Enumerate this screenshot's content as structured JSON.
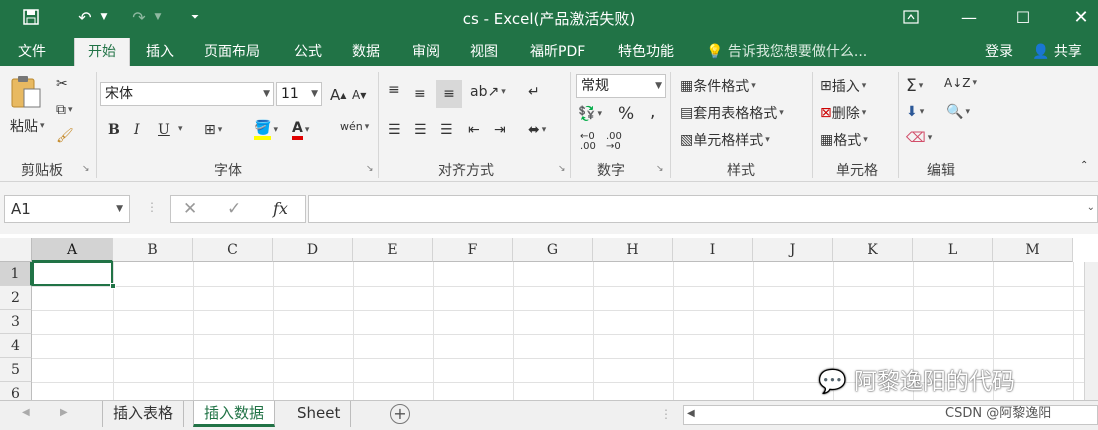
{
  "window": {
    "title": "cs - Excel(产品激活失败)"
  },
  "menu": {
    "tabs": [
      "文件",
      "开始",
      "插入",
      "页面布局",
      "公式",
      "数据",
      "审阅",
      "视图",
      "福昕PDF",
      "特色功能"
    ],
    "active": "开始",
    "tell_me": "告诉我您想要做什么...",
    "login": "登录",
    "share": "共享"
  },
  "ribbon": {
    "clipboard": {
      "paste": "粘贴",
      "label": "剪贴板"
    },
    "font": {
      "name": "宋体",
      "size": "11",
      "bold": "B",
      "italic": "I",
      "underline": "U",
      "label": "字体"
    },
    "alignment": {
      "label": "对齐方式"
    },
    "number": {
      "format": "常规",
      "percent": "%",
      "comma": ",",
      "label": "数字"
    },
    "styles": {
      "conditional": "条件格式",
      "table": "套用表格格式",
      "cell": "单元格样式",
      "label": "样式"
    },
    "cells": {
      "insert": "插入",
      "delete": "删除",
      "format": "格式",
      "label": "单元格"
    },
    "editing": {
      "label": "编辑"
    }
  },
  "formula_bar": {
    "name_box": "A1",
    "fx": "fx",
    "value": ""
  },
  "grid": {
    "columns": [
      "A",
      "B",
      "C",
      "D",
      "E",
      "F",
      "G",
      "H",
      "I",
      "J",
      "K",
      "L",
      "M"
    ],
    "rows": [
      "1",
      "2",
      "3",
      "4",
      "5",
      "6"
    ],
    "active_cell": "A1"
  },
  "sheets": {
    "tabs": [
      "插入表格",
      "插入数据",
      "Sheet"
    ],
    "active": "插入数据"
  },
  "overlay": {
    "wechat": "阿黎逸阳的代码",
    "csdn": "CSDN @阿黎逸阳"
  },
  "colors": {
    "accent": "#217346"
  }
}
